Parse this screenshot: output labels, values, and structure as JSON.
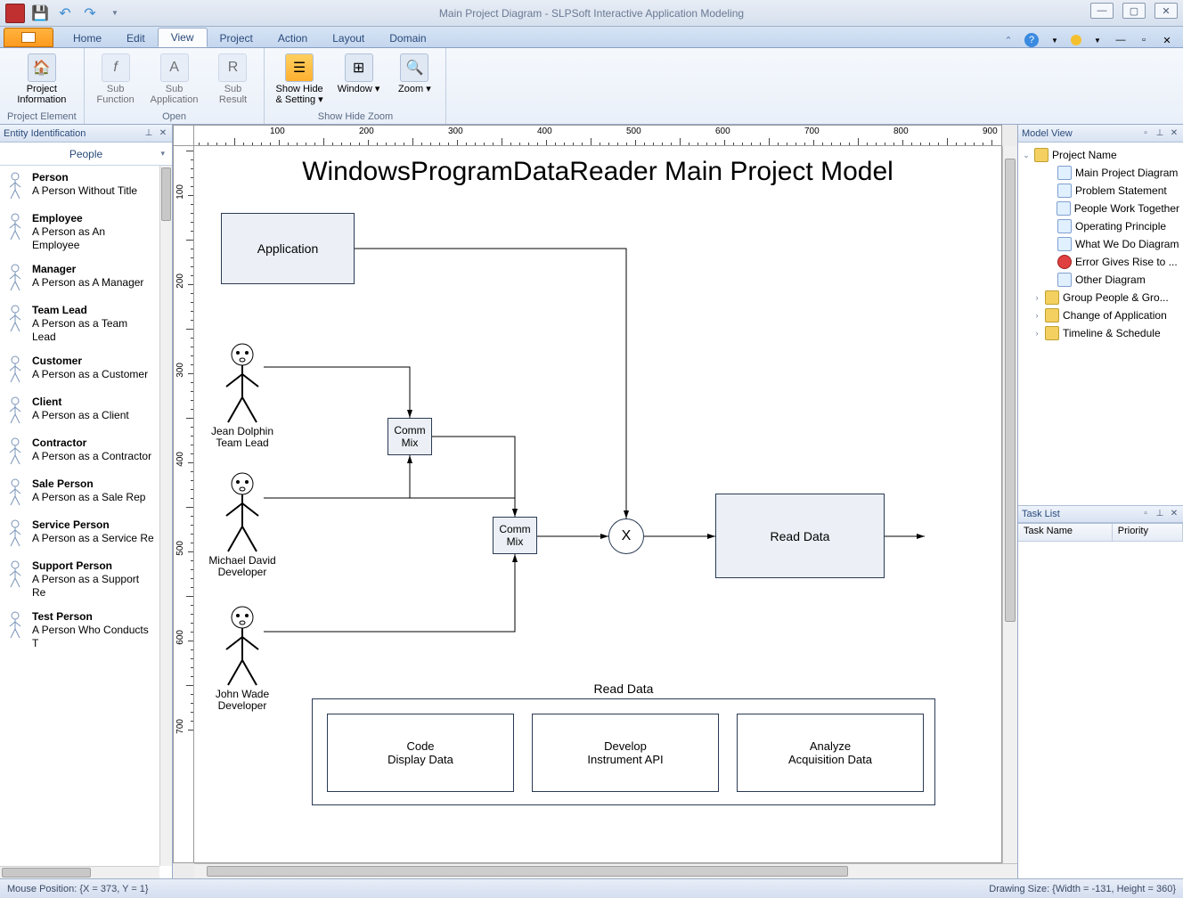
{
  "window": {
    "title": "Main Project Diagram - SLPSoft Interactive Application Modeling"
  },
  "menu": {
    "tabs": [
      "Home",
      "Edit",
      "View",
      "Project",
      "Action",
      "Layout",
      "Domain"
    ],
    "active_index": 2
  },
  "ribbon": {
    "project_element": {
      "caption": "Project Element",
      "project_info": "Project\nInformation"
    },
    "open": {
      "caption": "Open",
      "sub_function": "Sub\nFunction",
      "sub_application": "Sub\nApplication",
      "sub_result": "Sub\nResult"
    },
    "showhidezoom": {
      "caption": "Show Hide Zoom",
      "show_hide": "Show Hide\n& Setting ▾",
      "window": "Window ▾",
      "zoom": "Zoom ▾"
    }
  },
  "left_panel": {
    "title": "Entity Identification",
    "dropdown": "People",
    "items": [
      {
        "t": "Person",
        "d": "A Person Without Title"
      },
      {
        "t": "Employee",
        "d": "A Person as An Employee"
      },
      {
        "t": "Manager",
        "d": "A Person as A Manager"
      },
      {
        "t": "Team Lead",
        "d": "A Person as a Team Lead"
      },
      {
        "t": "Customer",
        "d": "A Person as a Customer"
      },
      {
        "t": "Client",
        "d": "A Person as a Client"
      },
      {
        "t": "Contractor",
        "d": "A Person as a Contractor"
      },
      {
        "t": "Sale Person",
        "d": "A Person as a Sale Rep"
      },
      {
        "t": "Service Person",
        "d": "A Person as a Service Re"
      },
      {
        "t": "Support Person",
        "d": "A Person as a Support Re"
      },
      {
        "t": "Test Person",
        "d": "A Person Who Conducts T"
      }
    ]
  },
  "diagram": {
    "title": "WindowsProgramDataReader Main Project Model",
    "application": "Application",
    "comm_mix": "Comm\nMix",
    "comm_mix2": "Comm\nMix",
    "gateway": "X",
    "read_data": "Read Data",
    "group_title": "Read Data",
    "code": "Code\nDisplay Data",
    "develop": "Develop\nInstrument API",
    "analyze": "Analyze\nAcquisition Data",
    "p1": "Jean Dolphin\nTeam Lead",
    "p2": "Michael David\nDeveloper",
    "p3": "John Wade\nDeveloper"
  },
  "model_view": {
    "title": "Model View",
    "root": "Project Name",
    "items": [
      "Main Project Diagram",
      "Problem Statement",
      "People Work Together",
      "Operating Principle",
      "What We Do Diagram",
      "Error Gives Rise to ...",
      "Other Diagram"
    ],
    "folders": [
      "Group People & Gro...",
      "Change of Application",
      "Timeline & Schedule"
    ]
  },
  "task_list": {
    "title": "Task List",
    "col1": "Task Name",
    "col2": "Priority"
  },
  "status": {
    "mouse": "Mouse Position: {X = 373,  Y = 1}",
    "drawing": "Drawing Size: {Width = -131, Height = 360}"
  },
  "ruler_h": [
    100,
    200,
    300,
    400,
    500,
    600,
    700,
    800,
    900
  ],
  "ruler_v": [
    100,
    200,
    300,
    400,
    500,
    600,
    700
  ]
}
